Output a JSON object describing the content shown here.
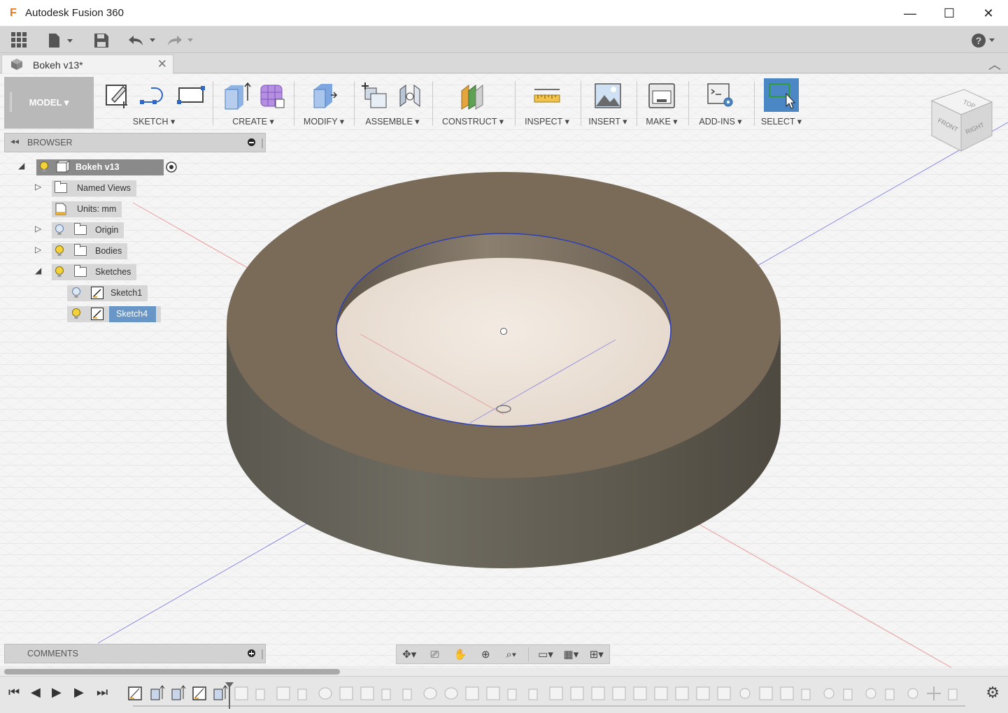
{
  "window": {
    "app_title": "Autodesk Fusion 360",
    "minimize": "—",
    "maximize": "☐",
    "close": "✕"
  },
  "qat": {
    "apps_icon": "grid-icon",
    "file_icon": "file-icon",
    "save_icon": "save-icon",
    "undo_icon": "undo-icon",
    "redo_icon": "redo-icon",
    "help_icon": "help-icon"
  },
  "document_tab": {
    "name": "Bokeh v13*",
    "close": "✕"
  },
  "ribbon": {
    "workspace": "MODEL ▾",
    "groups": [
      {
        "label": "SKETCH ▾"
      },
      {
        "label": "CREATE ▾"
      },
      {
        "label": "MODIFY ▾"
      },
      {
        "label": "ASSEMBLE ▾"
      },
      {
        "label": "CONSTRUCT ▾"
      },
      {
        "label": "INSPECT ▾"
      },
      {
        "label": "INSERT ▾"
      },
      {
        "label": "MAKE ▾"
      },
      {
        "label": "ADD-INS ▾"
      },
      {
        "label": "SELECT ▾"
      }
    ]
  },
  "browser": {
    "title": "BROWSER",
    "root": "Bokeh v13",
    "items": [
      {
        "label": "Named Views"
      },
      {
        "label": "Units: mm"
      },
      {
        "label": "Origin"
      },
      {
        "label": "Bodies"
      },
      {
        "label": "Sketches"
      },
      {
        "label": "Sketch1"
      },
      {
        "label": "Sketch4"
      }
    ]
  },
  "viewcube": {
    "top": "TOP",
    "front": "FRONT",
    "right": "RIGHT"
  },
  "comments": {
    "title": "COMMENTS"
  },
  "colors": {
    "accent": "#4a87c4",
    "selected_row": "#6896c6",
    "ring_top": "#7a6a57",
    "ring_side": "#5f5b52"
  }
}
